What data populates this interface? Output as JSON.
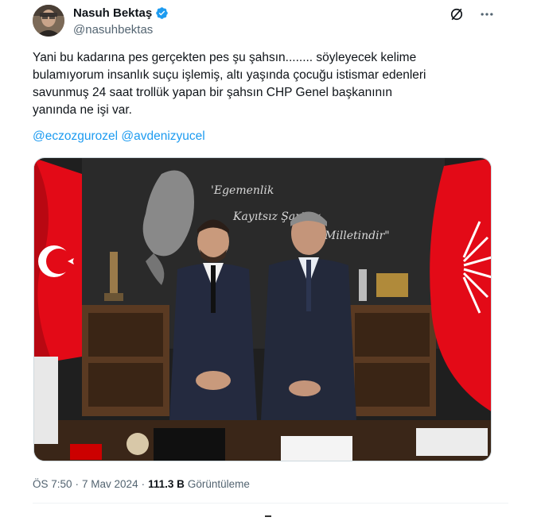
{
  "author": {
    "display_name": "Nasuh Bektaş",
    "handle": "@nasuhbektas",
    "verified": true
  },
  "icons": {
    "grok": "grok-icon",
    "more": "more-icon",
    "verified": "verified-badge-icon"
  },
  "tweet": {
    "line1": "Yani bu kadarına pes gerçekten pes şu şahsın........ söyleyecek kelime",
    "line2": "bulamıyorum insanlık suçu işlemiş, altı yaşında çocuğu istismar edenleri",
    "line3": "savunmuş 24 saat trollük yapan bir şahsın CHP Genel başkanının",
    "line4": "yanında ne işi var.",
    "mention1": "@eczozgurozel",
    "mention2": "@avdenizyucel"
  },
  "photo": {
    "wall_text_1": "'Egemenlik",
    "wall_text_2": "Kayıtsız Şartsız",
    "wall_text_3": "Milletindir\""
  },
  "meta": {
    "time": "ÖS 7:50",
    "sep1": "·",
    "date": "7 Mav 2024",
    "sep2": "·",
    "views_count": "111.3 B",
    "views_label": "Görüntüleme"
  },
  "colors": {
    "accent": "#1d9bf0",
    "text": "#0f1419",
    "secondary": "#536471",
    "flag_red": "#e30a17"
  }
}
